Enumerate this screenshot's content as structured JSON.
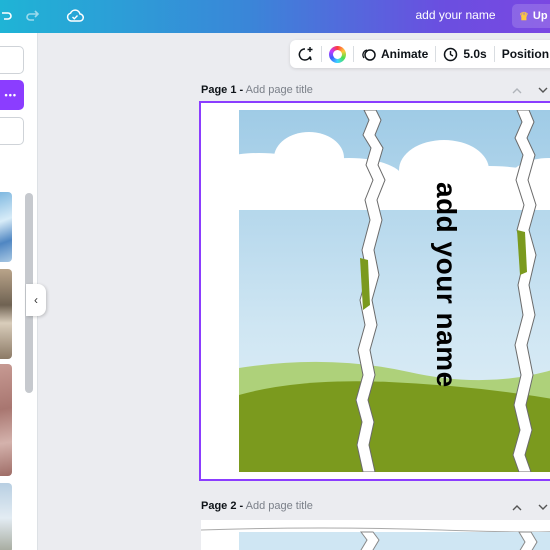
{
  "topbar": {
    "doc_title": "add your name",
    "upgrade_label": "Up"
  },
  "toolbar": {
    "animate_label": "Animate",
    "duration_label": "5.0s",
    "position_label": "Position"
  },
  "pages": [
    {
      "number_label": "Page 1 -",
      "title_placeholder": "Add page title"
    },
    {
      "number_label": "Page 2 -",
      "title_placeholder": "Add page title"
    }
  ],
  "canvas": {
    "text": "add your name"
  },
  "colors": {
    "accent": "#8b3dff",
    "sky": "#c9e3f3",
    "grass": "#7b9a1e"
  },
  "icons": {
    "undo": "undo-icon",
    "redo": "redo-icon",
    "cloud_save": "cloud-save-icon",
    "crown": "crown-icon",
    "speech_plus": "comment-add-icon",
    "color": "color-wheel-icon",
    "animate": "animate-icon",
    "clock": "clock-icon",
    "chevron_left": "chevron-left-icon",
    "chevron_up": "chevron-up-icon",
    "chevron_down": "chevron-down-icon"
  }
}
